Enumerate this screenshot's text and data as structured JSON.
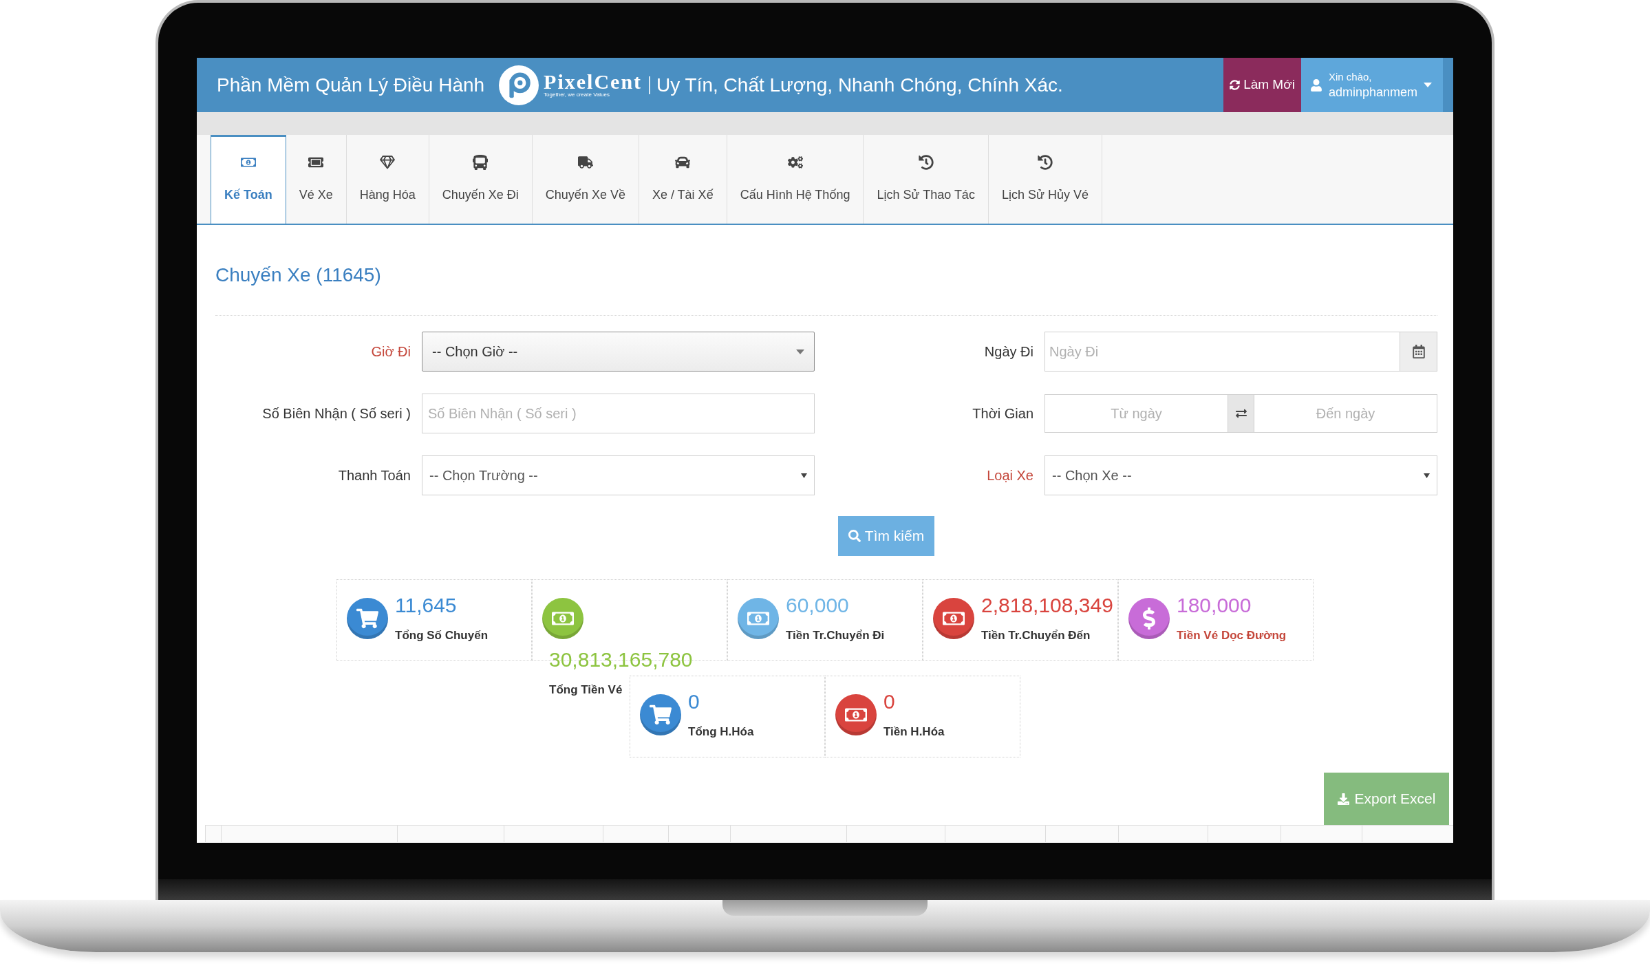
{
  "header": {
    "title": "Phần Mềm Quản Lý Điều Hành",
    "logo": {
      "name": "PixelCent",
      "tagline": "Together, we create Values"
    },
    "slogan": "Uy Tín, Chất Lượng, Nhanh Chóng, Chính Xác.",
    "refresh_button": "Làm Mới",
    "user": {
      "greeting": "Xin chào,",
      "name": "adminphanmem"
    }
  },
  "tabs": [
    {
      "label": "Kế Toán",
      "selected": true
    },
    {
      "label": "Vé Xe",
      "selected": false
    },
    {
      "label": "Hàng Hóa",
      "selected": false
    },
    {
      "label": "Chuyến Xe Đi",
      "selected": false
    },
    {
      "label": "Chuyến Xe Về",
      "selected": false
    },
    {
      "label": "Xe / Tài Xế",
      "selected": false
    },
    {
      "label": "Cấu Hình Hệ Thống",
      "selected": false
    },
    {
      "label": "Lịch Sử Thao Tác",
      "selected": false
    },
    {
      "label": "Lịch Sử Hủy Vé",
      "selected": false
    }
  ],
  "page_title": "Chuyến Xe (11645)",
  "filters": [
    {
      "kind": "picker",
      "label": "Giờ Đi",
      "required": true,
      "value": "-- Chọn Giờ --"
    },
    {
      "kind": "date",
      "label": "Ngày Đi",
      "required": false,
      "placeholder": "Ngày Đi"
    },
    {
      "kind": "text",
      "label": "Số Biên Nhận ( Số seri )",
      "required": false,
      "placeholder": "Số Biên Nhận ( Số seri )"
    },
    {
      "kind": "range",
      "label": "Thời Gian",
      "required": false,
      "from_placeholder": "Từ ngày",
      "to_placeholder": "Đến ngày"
    },
    {
      "kind": "select",
      "label": "Thanh Toán",
      "required": false,
      "value": "-- Chọn Trường --"
    },
    {
      "kind": "select",
      "label": "Loại Xe",
      "required": true,
      "value": "-- Chọn Xe --"
    }
  ],
  "search_button": "Tìm kiếm",
  "summary_rows": [
    {
      "items": [
        {
          "kind": "count",
          "color": "#3b8ad3",
          "value": "11,645",
          "label": "Tổng Số Chuyến",
          "highlighted": false
        },
        {
          "kind": "amount",
          "color": "#8dc440",
          "value": "30,813,165,780",
          "label": "Tổng Tiền Vé",
          "highlighted": false
        },
        {
          "kind": "amount",
          "color": "#6fb5e6",
          "value": "60,000",
          "label": "Tiền Tr.Chuyển Đi",
          "highlighted": false
        },
        {
          "kind": "amount",
          "color": "#d9443e",
          "value": "2,818,108,349",
          "label": "Tiền Tr.Chuyển Đến",
          "highlighted": false
        },
        {
          "kind": "fare",
          "color": "#c86cd8",
          "value": "180,000",
          "label": "Tiền Vé Dọc Đường",
          "highlighted": true
        }
      ]
    },
    {
      "items": [
        {
          "kind": "count",
          "color": "#3b8ad3",
          "value": "0",
          "label": "Tổng H.Hóa",
          "highlighted": false
        },
        {
          "kind": "amount",
          "color": "#d9443e",
          "value": "0",
          "label": "Tiền H.Hóa",
          "highlighted": false
        }
      ]
    }
  ],
  "export_button": "Export Excel"
}
